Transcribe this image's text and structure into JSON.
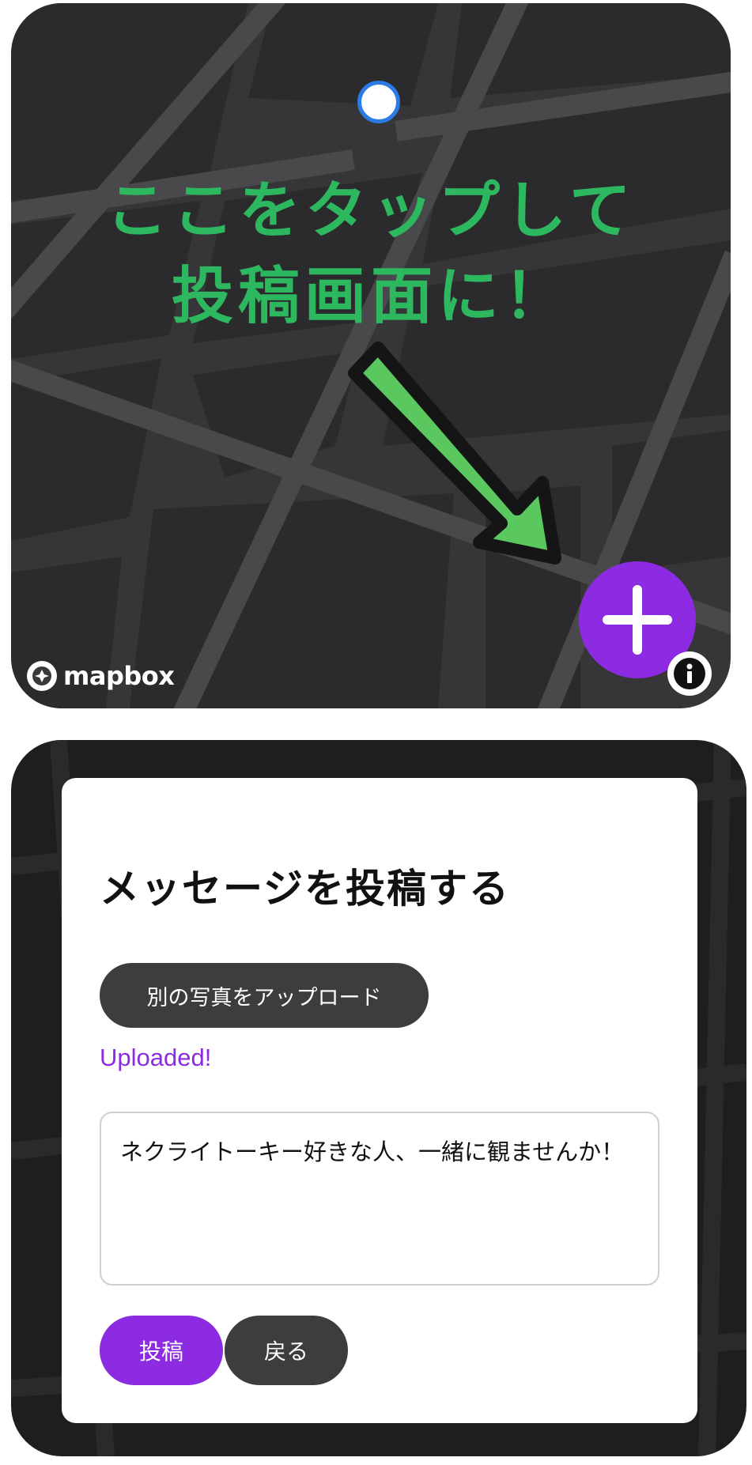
{
  "map": {
    "tap_hint_line1": "ここをタップして",
    "tap_hint_line2": "投稿画面に！",
    "attribution_logo": "mapbox",
    "icons": {
      "location_dot": "user-location-icon",
      "add_button": "plus-icon",
      "info_button": "info-icon",
      "hint_arrow": "arrow-down-right-icon"
    },
    "colors": {
      "hint_text": "#2db85f",
      "arrow": "#5ac85f",
      "fab": "#8c2be2",
      "location_dot_border": "#2a7be4"
    }
  },
  "modal": {
    "title": "メッセージを投稿する",
    "upload_button_label": "別の写真をアップロード",
    "upload_status": "Uploaded!",
    "message_text": "ネクライトーキー好きな人、一緒に観ませんか！",
    "post_button_label": "投稿",
    "back_button_label": "戻る",
    "colors": {
      "primary": "#8c2be2",
      "secondary": "#3d3d3d"
    }
  }
}
